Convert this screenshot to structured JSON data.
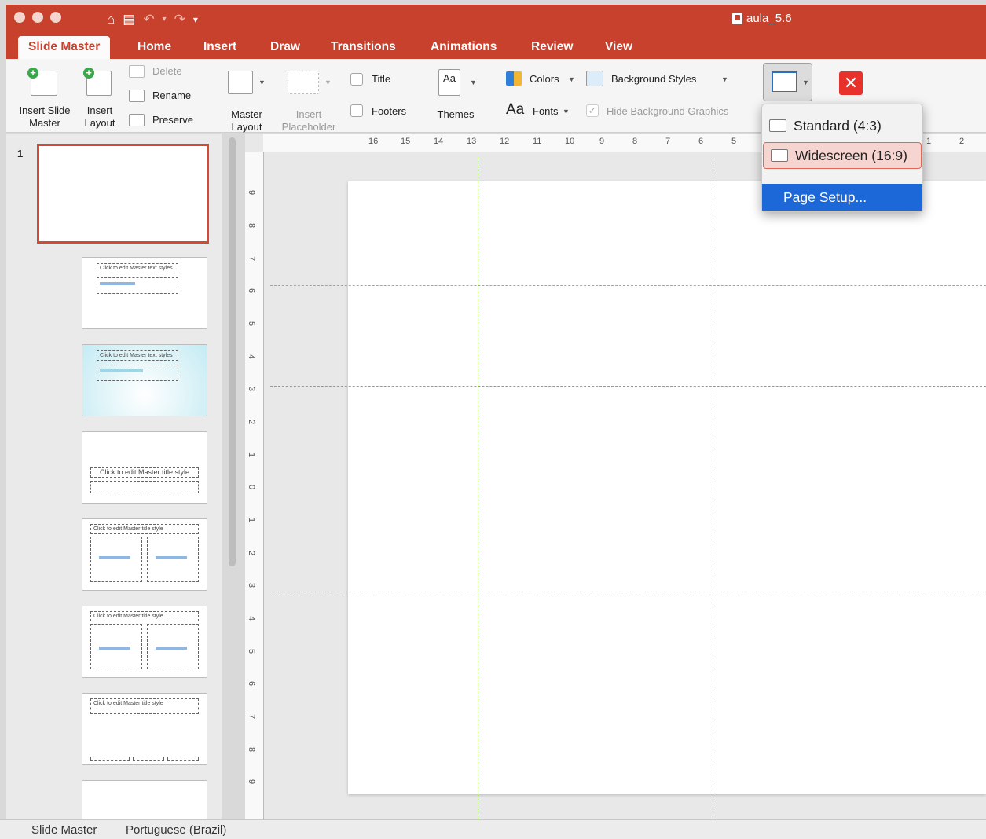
{
  "window": {
    "title": "aula_5.6"
  },
  "tabs": [
    {
      "label": "Slide Master",
      "active": true
    },
    {
      "label": "Home"
    },
    {
      "label": "Insert"
    },
    {
      "label": "Draw"
    },
    {
      "label": "Transitions"
    },
    {
      "label": "Animations"
    },
    {
      "label": "Review"
    },
    {
      "label": "View"
    }
  ],
  "ribbon": {
    "insert_slide_master": "Insert Slide Master",
    "insert_slide_master_l1": "Insert Slide",
    "insert_slide_master_l2": "Master",
    "insert_layout_l1": "Insert",
    "insert_layout_l2": "Layout",
    "delete": "Delete",
    "rename": "Rename",
    "preserve": "Preserve",
    "master_layout_l1": "Master",
    "master_layout_l2": "Layout",
    "insert_placeholder_l1": "Insert",
    "insert_placeholder_l2": "Placeholder",
    "title": "Title",
    "footers": "Footers",
    "themes": "Themes",
    "themes_glyph": "Aa",
    "colors": "Colors",
    "fonts": "Fonts",
    "fonts_glyph": "Aa",
    "background_styles": "Background Styles",
    "hide_background_graphics": "Hide Background Graphics",
    "hide_background_checked": true
  },
  "slide_size_menu": {
    "items": [
      {
        "label": "Standard (4:3)"
      },
      {
        "label": "Widescreen (16:9)",
        "selected": true
      },
      {
        "label": "Page Setup...",
        "highlighted": true
      }
    ]
  },
  "thumbnails": {
    "first_number": "1",
    "text_styles": "Click to edit Master text styles",
    "title_style": "Click to edit Master title style"
  },
  "ruler": {
    "horizontal_ticks": [
      "16",
      "15",
      "14",
      "13",
      "12",
      "11",
      "10",
      "9",
      "8",
      "7",
      "6",
      "5",
      "1",
      "2"
    ],
    "vertical_ticks": [
      "9",
      "8",
      "7",
      "6",
      "5",
      "4",
      "3",
      "2",
      "1",
      "0",
      "1",
      "2",
      "3",
      "4",
      "5",
      "6",
      "7",
      "8",
      "9"
    ]
  },
  "colors": {
    "accent": "#c8412d",
    "guide_green": "#8bc34a",
    "guide_orange": "#ef7a52",
    "menu_highlight": "#1c68d9"
  },
  "status": {
    "view": "Slide Master",
    "language": "Portuguese (Brazil)"
  }
}
